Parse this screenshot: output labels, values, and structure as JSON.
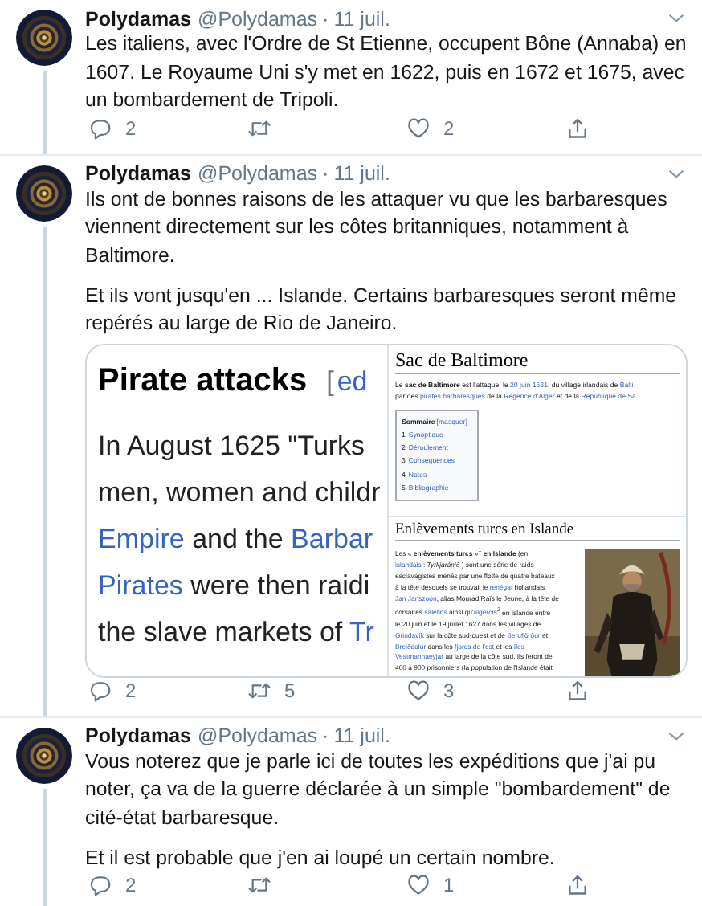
{
  "tweets": [
    {
      "author": "Polydamas",
      "handle": "@Polydamas",
      "dot": "·",
      "date": "11 juil.",
      "paragraphs": [
        "Les italiens, avec l'Ordre de St Etienne, occupent Bône (Annaba) en 1607. Le Royaume Uni s'y met en 1622, puis en 1672 et 1675, avec un bombardement de Tripoli."
      ],
      "actions": [
        {
          "kind": "reply",
          "count": "2"
        },
        {
          "kind": "retweet"
        },
        {
          "kind": "like",
          "count": "2"
        },
        {
          "kind": "share"
        }
      ]
    },
    {
      "author": "Polydamas",
      "handle": "@Polydamas",
      "dot": "·",
      "date": "11 juil.",
      "paragraphs": [
        "Ils ont de bonnes raisons de les attaquer vu que les barbaresques viennent directement sur les côtes britanniques, notamment à Baltimore.",
        "Et ils vont jusqu'en ... Islande. Certains barbaresques seront même repérés au large de Rio de Janeiro."
      ],
      "media": {
        "left": {
          "heading": "Pirate attacks",
          "edit_bracket": "[",
          "edit_link": "ed",
          "lines": [
            [
              {
                "t": "In August 1625 \"Turks"
              }
            ],
            [
              {
                "t": "men, women and childr"
              }
            ],
            [
              {
                "t": "Empire",
                "link": true
              },
              {
                "t": " and the "
              },
              {
                "t": "Barbar",
                "link": true
              }
            ],
            [
              {
                "t": "Pirates",
                "link": true
              },
              {
                "t": " were then raidi"
              }
            ],
            [
              {
                "t": "the slave markets of "
              },
              {
                "t": "Tr",
                "link": true
              }
            ]
          ]
        },
        "articles": [
          {
            "title": "Sac de Baltimore",
            "lines": [
              [
                {
                  "t": "Le **sac de Baltimore** est l'attaque, le "
                },
                {
                  "t": "20 juin 1631",
                  "link": true
                },
                {
                  "t": ", du village irlandais de "
                },
                {
                  "t": "Balti",
                  "link": true
                }
              ],
              [
                {
                  "t": "par des "
                },
                {
                  "t": "pirates barbaresques",
                  "link": true
                },
                {
                  "t": " de la "
                },
                {
                  "t": "Régence d'Alger",
                  "link": true
                },
                {
                  "t": " et de la "
                },
                {
                  "t": "République de Sa",
                  "link": true
                }
              ]
            ],
            "toc": {
              "heading": "Sommaire",
              "toggle": "[masquer]",
              "items": [
                {
                  "num": "1",
                  "label": "Synoptique"
                },
                {
                  "num": "2",
                  "label": "Déroulement"
                },
                {
                  "num": "3",
                  "label": "Conséquences"
                },
                {
                  "num": "4",
                  "label": "Notes"
                },
                {
                  "num": "5",
                  "label": "Bibliographie"
                }
              ]
            }
          },
          {
            "title": "Enlèvements turcs en Islande",
            "lines": [
              [
                {
                  "t": "Les « **enlèvements turcs** »$^{1}$ **en Islande** (en"
                }
              ],
              [
                {
                  "t": "islandais",
                  "link": true
                },
                {
                  "t": " : *Tyrkjaránið* ) sont une série de raids"
                }
              ],
              [
                {
                  "t": "esclavagistes menés par une flotte de quatre bateaux"
                }
              ],
              [
                {
                  "t": "à la tête desquels se trouvait le "
                },
                {
                  "t": "renégat",
                  "link": true
                },
                {
                  "t": " hollandais"
                }
              ],
              [
                {
                  "t": "Jan Janszoon",
                  "link": true
                },
                {
                  "t": ", alias Mourad Raïs le Jeune, à la tête de"
                }
              ],
              [
                {
                  "t": "corsaires "
                },
                {
                  "t": "salétins",
                  "link": true
                },
                {
                  "t": " ainsi qu'"
                },
                {
                  "t": "algérois",
                  "link": true
                },
                {
                  "t": "$^{2}$ en Islande entre"
                }
              ],
              [
                {
                  "t": "le 20 juin et le 19 juillet 1627 dans les villages de"
                }
              ],
              [
                {
                  "t": "Grindavík",
                  "link": true
                },
                {
                  "t": " sur la côte sud-ouest et de "
                },
                {
                  "t": "Berufjörður",
                  "link": true
                },
                {
                  "t": " et"
                }
              ],
              [
                {
                  "t": "Breiðdalur",
                  "link": true
                },
                {
                  "t": " dans les "
                },
                {
                  "t": "fjords de l'est",
                  "link": true
                },
                {
                  "t": " et les "
                },
                {
                  "t": "îles",
                  "link": true
                }
              ],
              [
                {
                  "t": "Vestmannaeyjar",
                  "link": true
                },
                {
                  "t": " au large de la côte sud. Ils feront de"
                }
              ],
              [
                {
                  "t": "400 à 900 prisonniers (la population de l'Islande était"
                }
              ]
            ],
            "figure": {
              "kind": "picture"
            }
          }
        ]
      },
      "actions": [
        {
          "kind": "reply",
          "count": "2"
        },
        {
          "kind": "retweet",
          "count": "5"
        },
        {
          "kind": "like",
          "count": "3"
        },
        {
          "kind": "share"
        }
      ]
    },
    {
      "author": "Polydamas",
      "handle": "@Polydamas",
      "dot": "·",
      "date": "11 juil.",
      "paragraphs": [
        "Vous noterez que je parle ici de toutes les expéditions que j'ai pu noter, ça va de la guerre déclarée à un simple \"bombardement\" de cité-état barbaresque.",
        "Et il est probable que j'en ai loupé un certain nombre."
      ],
      "actions": [
        {
          "kind": "reply",
          "count": "2"
        },
        {
          "kind": "retweet"
        },
        {
          "kind": "like",
          "count": "1"
        },
        {
          "kind": "share"
        }
      ]
    }
  ]
}
